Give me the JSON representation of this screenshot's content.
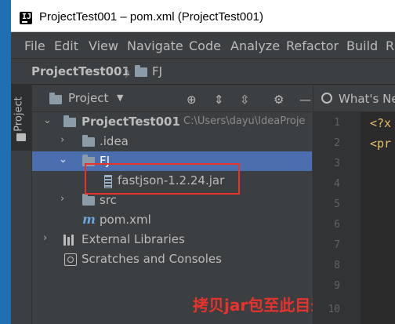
{
  "window": {
    "title": "ProjectTest001 – pom.xml (ProjectTest001)",
    "app_icon_text": "IJ"
  },
  "menu": [
    "File",
    "Edit",
    "View",
    "Navigate",
    "Code",
    "Analyze",
    "Refactor",
    "Build",
    "R"
  ],
  "navbar": {
    "project": "ProjectTest001",
    "folder": "FJ"
  },
  "tool_window": {
    "stripe_label": "Project",
    "title": "Project"
  },
  "tree": {
    "root": {
      "label": "ProjectTest001",
      "path": "C:\\Users\\dayu\\IdeaProje"
    },
    "idea": ".idea",
    "fj": "FJ",
    "jar": "fastjson-1.2.24.jar",
    "src": "src",
    "pom": "pom.xml",
    "ext_libs": "External Libraries",
    "scratches": "Scratches and Consoles"
  },
  "annotation": "拷贝jar包至此目录下",
  "editor": {
    "tab_label": "What's Ne",
    "line_numbers": [
      "1",
      "2",
      "3",
      "4",
      "5",
      "6",
      "7",
      "8",
      "9",
      "10"
    ],
    "code_lines": [
      "<?x",
      "<pr"
    ]
  },
  "colors": {
    "ide_background": "#3c3f41",
    "selection": "#4b6eaf",
    "annotation_red": "#e8322c"
  }
}
